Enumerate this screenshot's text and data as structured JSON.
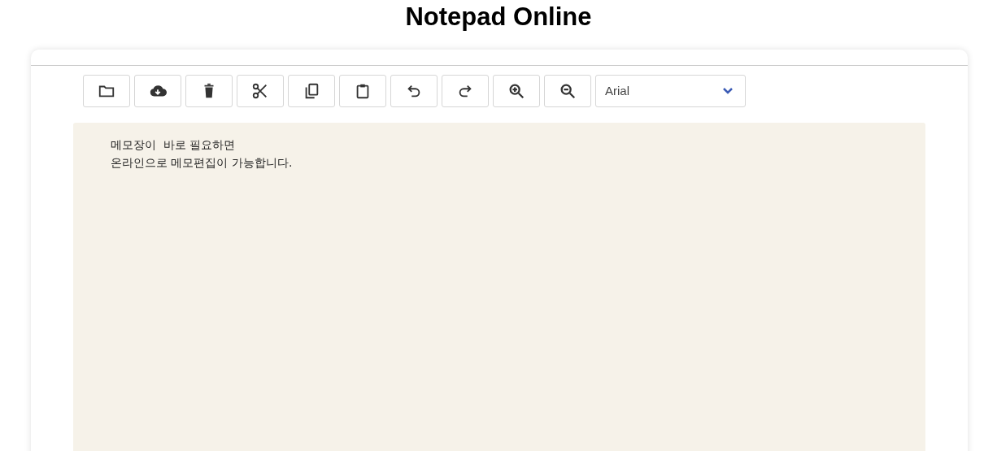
{
  "page_title": "Notepad Online",
  "toolbar": [
    {
      "kind": "folder"
    },
    {
      "kind": "cloud"
    },
    {
      "kind": "trash"
    },
    {
      "kind": "scissors"
    },
    {
      "kind": "copy"
    },
    {
      "kind": "clipboard"
    },
    {
      "kind": "undo"
    },
    {
      "kind": "redo"
    },
    {
      "kind": "zoomin"
    },
    {
      "kind": "zoomout"
    }
  ],
  "font_select": {
    "value": "Arial"
  },
  "editor": {
    "lines": [
      "메모장이  바로 필요하면",
      "온라인으로 메모편집이 가능합니다."
    ]
  }
}
